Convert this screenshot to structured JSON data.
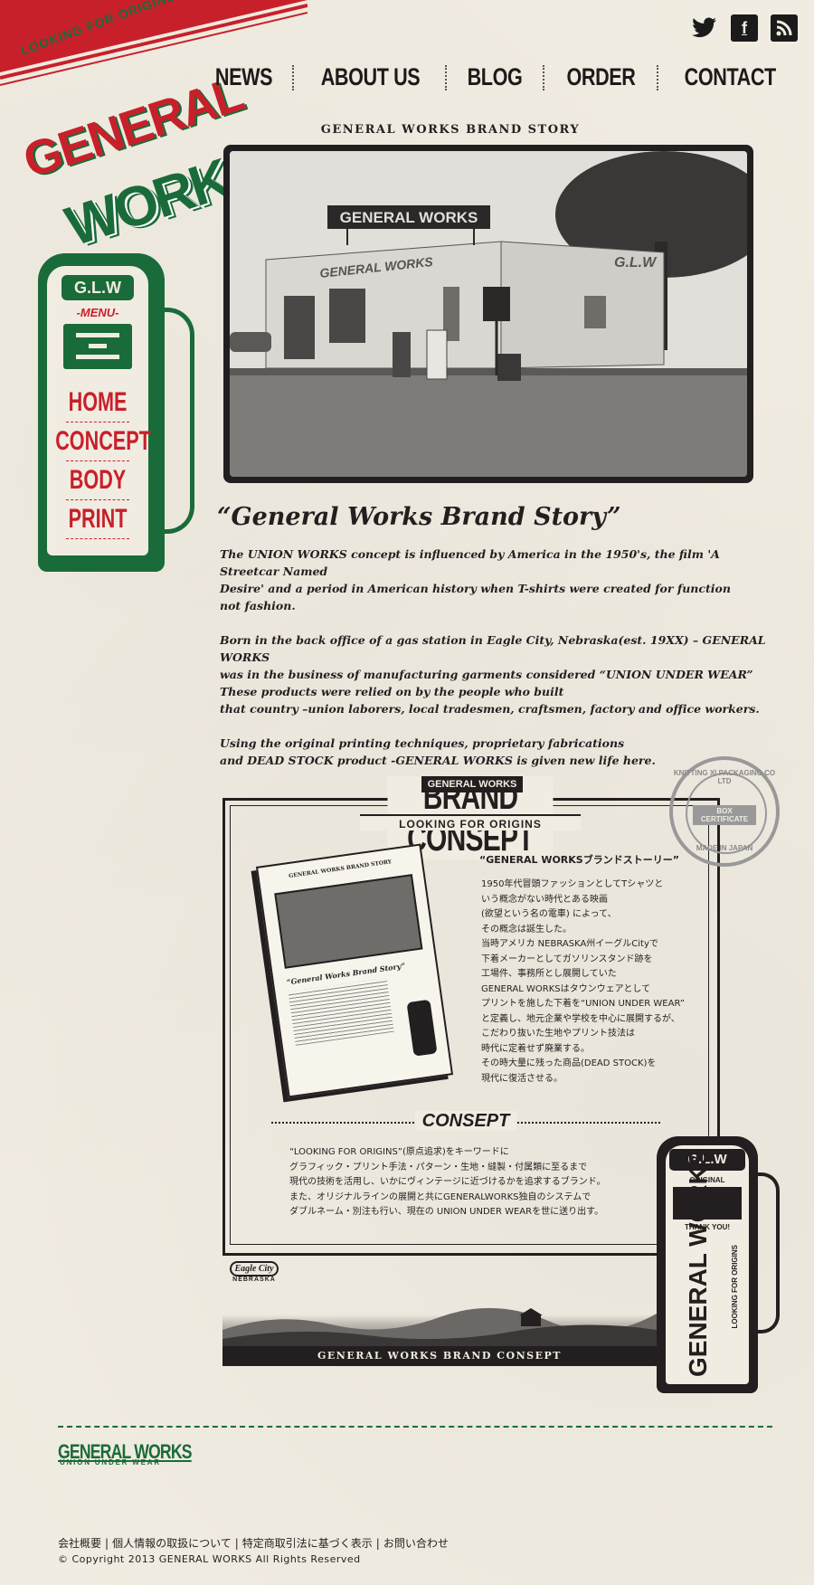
{
  "brand": {
    "arc_text": "LOOKING FOR ORIGINS",
    "name_top": "GENERAL",
    "name_bottom": "WORKS",
    "registered": "®"
  },
  "social": {
    "twitter": "twitter-icon",
    "facebook": "facebook-icon",
    "rss": "rss-icon",
    "facebook_glyph": "f"
  },
  "nav": {
    "items": [
      "NEWS",
      "ABOUT US",
      "BLOG",
      "ORDER",
      "CONTACT"
    ]
  },
  "sidebar": {
    "pump_label": "G.L.W",
    "menu_label": "-MENU-",
    "items": [
      "HOME",
      "CONCEPT",
      "BODY",
      "PRINT"
    ]
  },
  "story": {
    "heading": "GENERAL WORKS  BRAND STORY",
    "photo_sign": "GENERAL WORKS",
    "photo_wall": "GENERAL WORKS",
    "photo_glw": "G.L.W",
    "photo_post": "G.L.W GENERAL WORKS",
    "title": "“General Works Brand Story”",
    "paragraphs": [
      "The UNION WORKS concept is influenced by America in the 1950's, the film 'A Streetcar Named\nDesire' and a period in American history when T-shirts were created for function\nnot fashion.",
      "Born in the back office of a gas station in Eagle City, Nebraska(est. 19XX) – GENERAL WORKS\nwas in the business of manufacturing garments considered “UNION UNDER WEAR”\nThese products were relied on by the people who built\nthat country –union laborers, local tradesmen, craftsmen, factory and office workers.",
      "Using the original printing techniques, proprietary fabrications\nand DEAD STOCK product -GENERAL WORKS is given new life here."
    ]
  },
  "concept": {
    "title": "BRAND CONSEPT",
    "tag": "GENERAL WORKS",
    "subtitle": "LOOKING FOR ORIGINS",
    "stamp_top": "KNITTING XI PACKAGING CO LTD",
    "stamp_bottom": "MADE IN JAPAN",
    "stamp_center": "BOX CERTIFICATE",
    "card_title": "“General Works Brand Story”",
    "card_header": "GENERAL WORKS BRAND STORY",
    "jp_title": "“GENERAL WORKSブランドストーリー”",
    "jp_body": "1950年代冒頭ファッションとしてTシャツと\nいう概念がない時代とある映画\n(欲望という名の電車) によって、\nその概念は誕生した。\n当時アメリカ NEBRASKA州イーグルCityで\n下着メーカーとしてガソリンスタンド跡を\n工場件、事務所とし展開していた\nGENERAL WORKSはタウンウェアとして\nプリントを施した下着を“UNION UNDER WEAR”\nと定義し、地元企業や学校を中心に展開するが、\nこだわり抜いた生地やプリント技法は\n時代に定着せず廃業する。\nその時大量に残った商品(DEAD STOCK)を\n現代に復活させる。",
    "consept_label": "CONSEPT",
    "consept_body": "“LOOKING FOR ORIGINS”(原点追求)をキーワードに\nグラフィック・プリント手法・パターン・生地・縫製・付属類に至るまで\n現代の技術を活用し、いかにヴィンテージに近づけるかを追求するブランド。\nまた、オリジナルラインの展開と共にGENERALWORKS独自のシステムで\nダブルネーム・別注も行い、現在の UNION UNDER WEARを世に送り出す。",
    "pump_label": "G.L.W",
    "pump_original": "ORIGINAL",
    "pump_thanks": "THANK YOU!",
    "pump_vertical": "GENERAL WORKS",
    "pump_vertical_sub": "LOOKING FOR ORIGINS",
    "eagle_city": "Eagle City",
    "eagle_state": "NEBRASKA",
    "bottom_bar": "GENERAL WORKS   BRAND CONSEPT"
  },
  "footer": {
    "logo": "GENERAL WORKS",
    "logo_sub": "UNION UNDER WEAR",
    "links": [
      "会社概要",
      "個人情報の取扱について",
      "特定商取引法に基づく表示",
      "お問い合わせ"
    ],
    "copyright": "© Copyright 2013 GENERAL WORKS All Rights Reserved"
  },
  "colors": {
    "paper": "#f1ece1",
    "brand_red": "#c8202a",
    "brand_green": "#1a6b3a",
    "ink": "#231f20"
  }
}
